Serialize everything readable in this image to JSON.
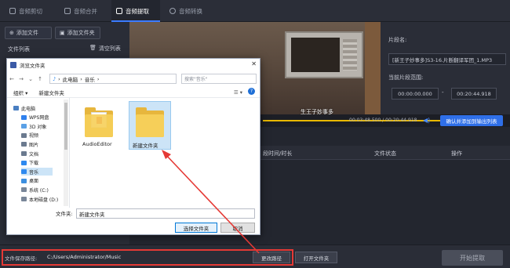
{
  "tabs": [
    {
      "label": "音频剪切",
      "icon": "scissors-icon"
    },
    {
      "label": "音频合并",
      "icon": "merge-icon"
    },
    {
      "label": "音频提取",
      "icon": "extract-icon",
      "active": true
    },
    {
      "label": "音频转换",
      "icon": "convert-icon"
    }
  ],
  "left_panel": {
    "add_file": "添加文件",
    "add_folder": "添加文件夹",
    "file_list": "文件列表",
    "clear_list": "清空列表"
  },
  "video": {
    "subtitle": "生王子妙事多"
  },
  "player": {
    "time": "00:03:48.500 / 00:20:44.918",
    "confirm_button": "确认并添加到输出列表"
  },
  "right_panel": {
    "segment_name_label": "片段名:",
    "segment_name": "[新王子妙事多]S3-16.片断翻译军团_1.MP3",
    "current_range_label": "当前片段范围:",
    "start_time": "00:00:00.000",
    "end_time": "00:20:44.918",
    "dash": "-"
  },
  "table": {
    "headers": [
      "段时间/时长",
      "文件状态",
      "操作"
    ]
  },
  "bottom": {
    "save_path_label": "文件保存路径:",
    "save_path": "C:/Users/Administrator/Music",
    "change_path": "更改路径",
    "open_folder": "打开文件夹",
    "start_extract": "开始提取"
  },
  "dialog": {
    "title": "浏览文件夹",
    "address": [
      "此电脑",
      "音乐"
    ],
    "search_placeholder": "搜索\"音乐\"",
    "organize": "组织 ▾",
    "new_folder": "新建文件夹",
    "tree": [
      {
        "label": "此电脑",
        "color": "#4a7fc1"
      },
      {
        "label": "WPS网盘",
        "color": "#2f80ed"
      },
      {
        "label": "3D 对象",
        "color": "#5aa0e6"
      },
      {
        "label": "视频",
        "color": "#6b7a8f"
      },
      {
        "label": "图片",
        "color": "#6b7a8f"
      },
      {
        "label": "文档",
        "color": "#6b7a8f"
      },
      {
        "label": "下载",
        "color": "#2d89ef"
      },
      {
        "label": "音乐",
        "color": "#2d89ef",
        "selected": true
      },
      {
        "label": "桌面",
        "color": "#3c8fe0"
      },
      {
        "label": "系统 (C:)",
        "color": "#7a8799"
      },
      {
        "label": "本地磁盘 (D:)",
        "color": "#7a8799"
      }
    ],
    "folders": [
      {
        "label": "AudioEditor"
      },
      {
        "label": "新建文件夹",
        "selected": true
      }
    ],
    "folder_name_label": "文件夹:",
    "folder_name": "新建文件夹",
    "select_button": "选择文件夹",
    "cancel_button": "取消"
  },
  "colors": {
    "accent": "#2f6fe8",
    "highlight": "#e53935",
    "progress": "#e8b800"
  }
}
